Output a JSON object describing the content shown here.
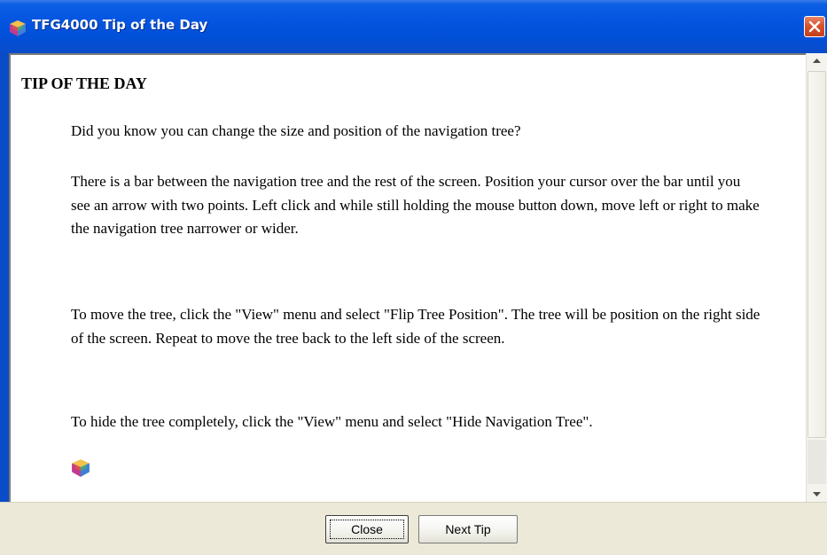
{
  "window": {
    "title": "TFG4000 Tip of the Day",
    "title_icon": "app-cube-icon",
    "close_icon": "close-icon"
  },
  "content": {
    "heading": "TIP OF THE DAY",
    "paragraphs": [
      "Did you know you can change the size and position of the navigation tree?",
      "There is a bar between the navigation tree and the rest of the screen. Position your cursor over the bar until you see an arrow with two points. Left click and while still holding the mouse button down, move left or right to make the navigation tree narrower or wider.",
      "To move the tree, click the \"View\" menu and select \"Flip Tree Position\".  The tree will be position on the right side of the screen. Repeat to move the tree back to the left side of the screen.",
      "To hide the tree completely, click the \"View\" menu and select \"Hide Navigation Tree\"."
    ],
    "footer_icon": "cube-icon"
  },
  "buttons": {
    "close_label": "Close",
    "next_label": "Next Tip"
  },
  "colors": {
    "titlebar": "#0454e0",
    "close_button": "#d9542e",
    "dialog_bg": "#ece9d8"
  }
}
